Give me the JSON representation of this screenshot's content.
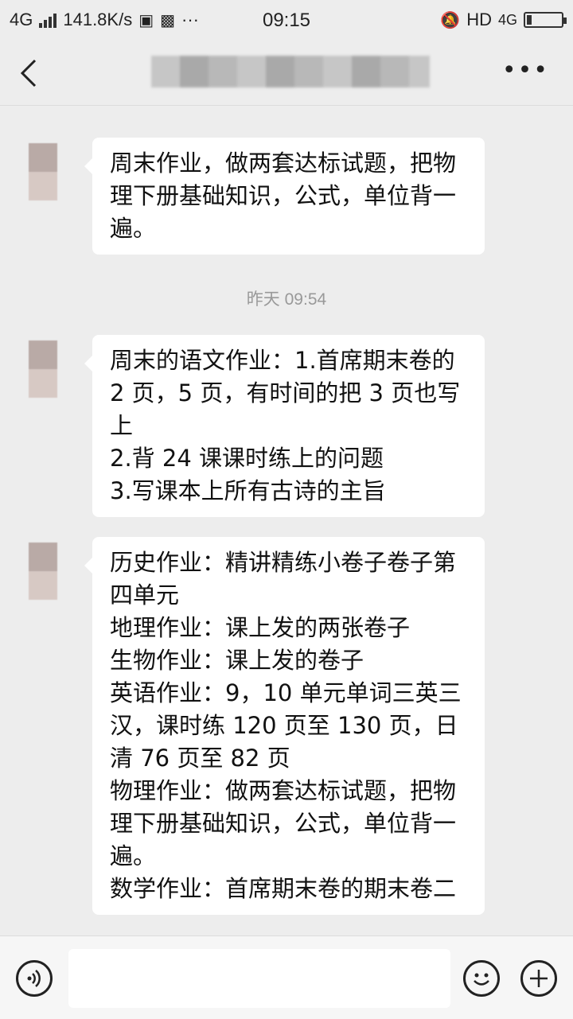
{
  "status_bar": {
    "network": "4G",
    "speed": "141.8K/s",
    "time": "09:15",
    "hd": "HD",
    "network_right": "4G"
  },
  "messages": [
    {
      "lines": [
        "周末作业，做两套达标试题，把物",
        "理下册基础知识，公式，单位背一",
        "遍。"
      ]
    },
    {
      "lines": [
        "周末的语文作业：1.首席期末卷的",
        "2 页，5 页，有时间的把 3 页也写",
        "上",
        "2.背 24 课课时练上的问题",
        "3.写课本上所有古诗的主旨"
      ]
    },
    {
      "lines": [
        "历史作业：精讲精练小卷子卷子第",
        "四单元",
        "地理作业：课上发的两张卷子",
        "生物作业：课上发的卷子",
        "英语作业：9，10 单元单词三英三",
        "汉，课时练 120 页至 130 页，日",
        "清 76 页至 82 页",
        "物理作业：做两套达标试题，把物",
        "理下册基础知识，公式，单位背一",
        "遍。",
        "数学作业：首席期末卷的期末卷二"
      ]
    }
  ],
  "timestamp": "昨天 09:54",
  "icons": {
    "back": "back-chevron-icon",
    "more": "more-dots-icon",
    "voice": "voice-icon",
    "emoji": "emoji-icon",
    "plus": "plus-icon"
  }
}
